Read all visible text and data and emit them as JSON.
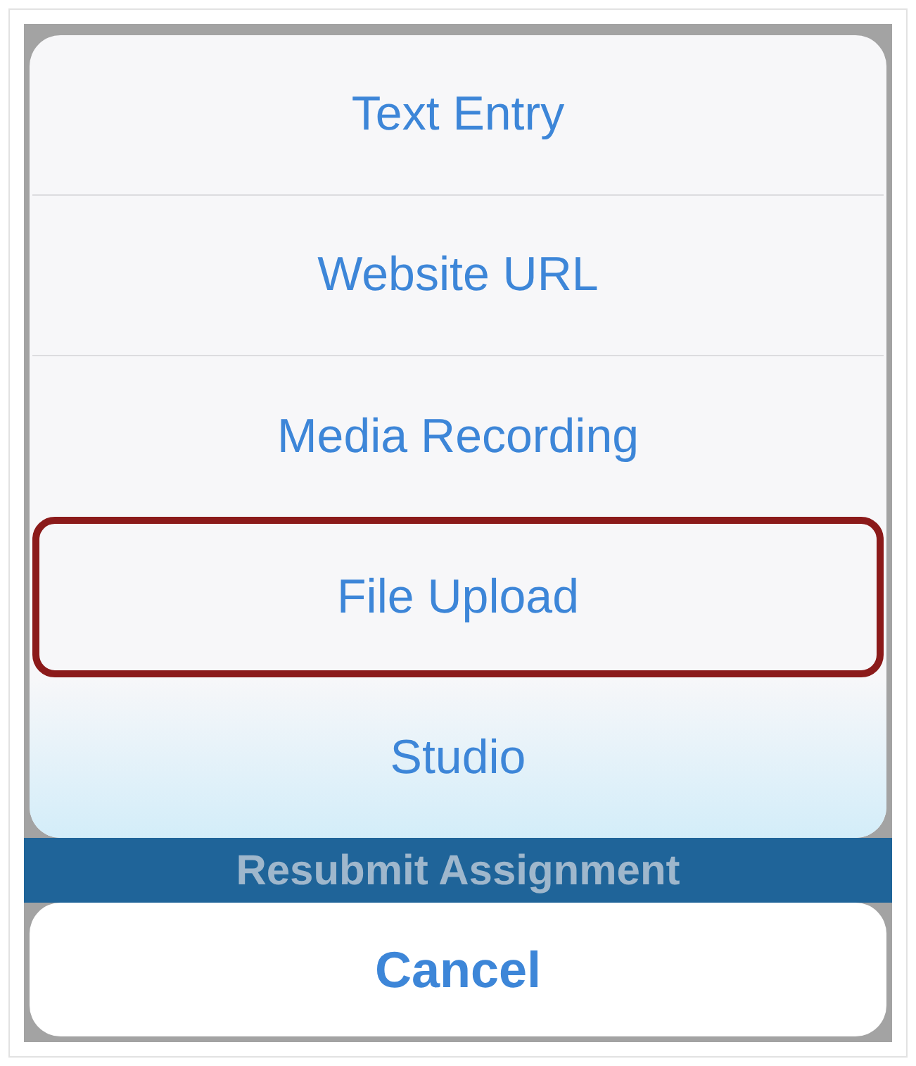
{
  "action_sheet": {
    "options": [
      {
        "label": "Text Entry",
        "selected": false
      },
      {
        "label": "Website URL",
        "selected": false
      },
      {
        "label": "Media Recording",
        "selected": false
      },
      {
        "label": "File Upload",
        "selected": true
      },
      {
        "label": "Studio",
        "selected": false
      }
    ],
    "cancel": "Cancel"
  },
  "background_button": "Resubmit Assignment"
}
